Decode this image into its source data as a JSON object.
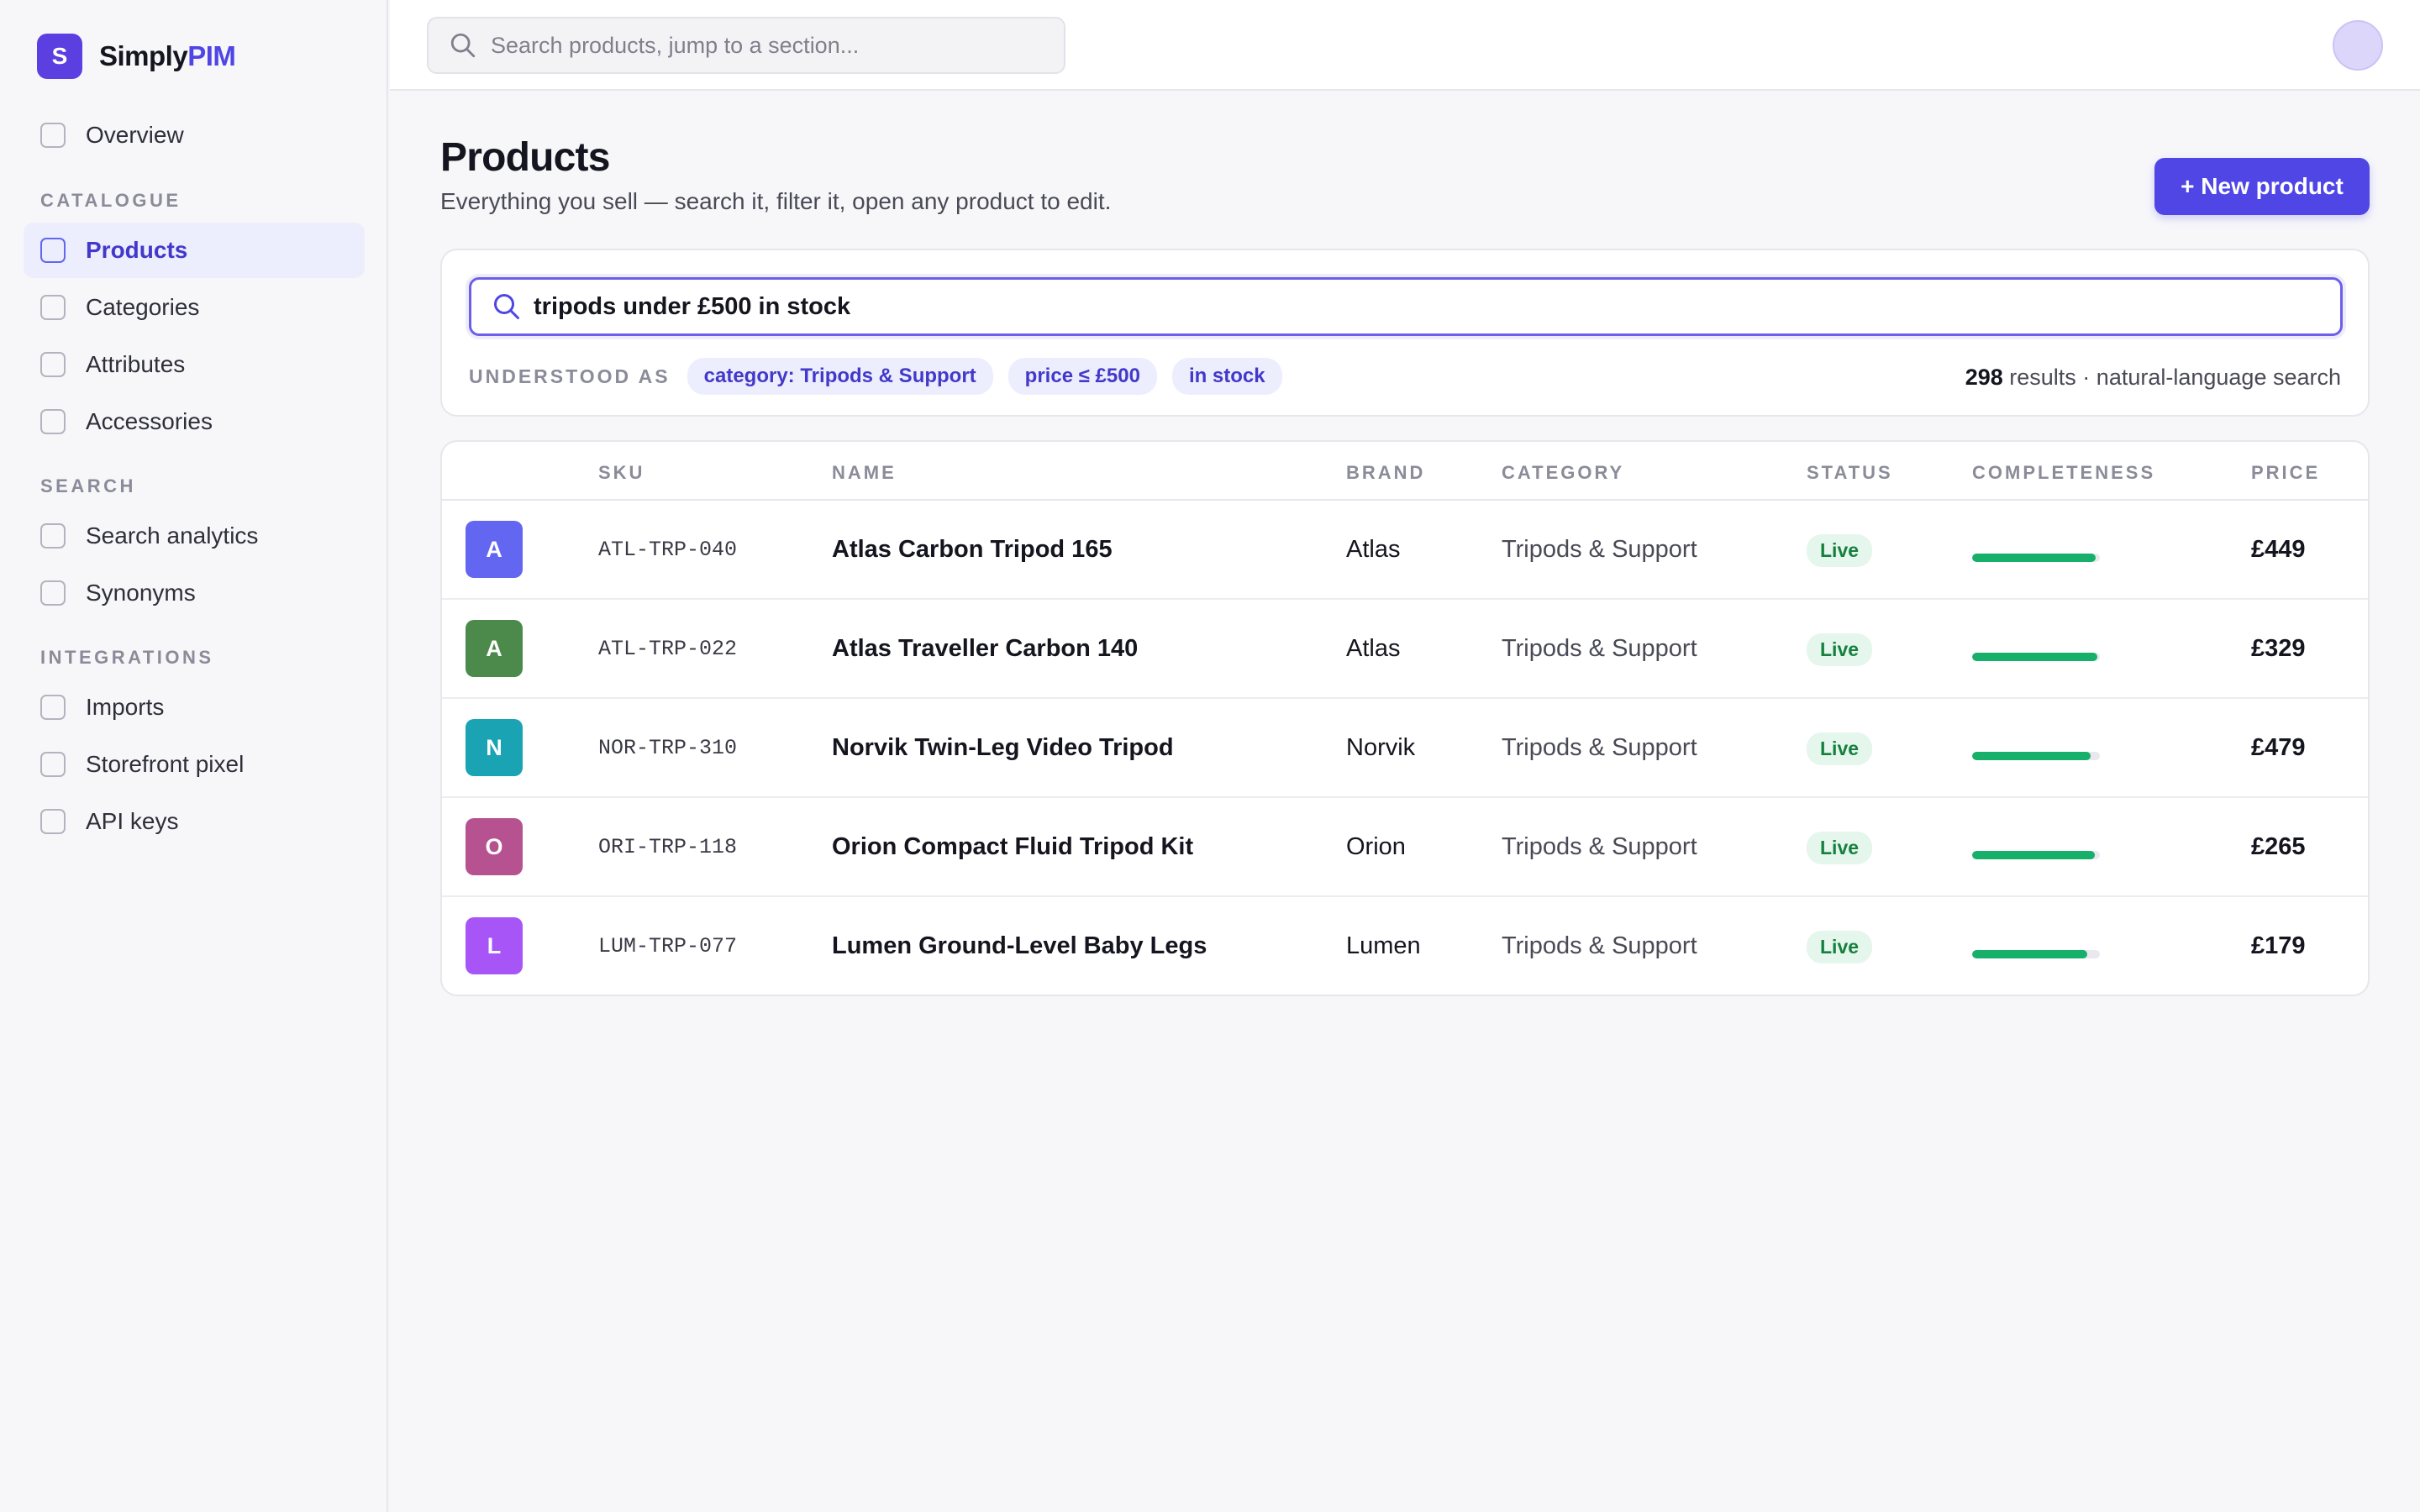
{
  "app": {
    "logo_letter": "S",
    "name_main": "Simply",
    "name_accent": "PIM",
    "accent_color": "#4f46e5"
  },
  "sidebar": {
    "overview": "Overview",
    "sections": {
      "catalogue": "CATALOGUE",
      "search": "SEARCH",
      "integrations": "INTEGRATIONS"
    },
    "items": [
      {
        "label": "Products",
        "active": true
      },
      {
        "label": "Categories"
      },
      {
        "label": "Attributes"
      },
      {
        "label": "Accessories"
      },
      {
        "label": "Search analytics"
      },
      {
        "label": "Synonyms"
      },
      {
        "label": "Imports"
      },
      {
        "label": "Storefront pixel"
      },
      {
        "label": "API keys"
      }
    ]
  },
  "topbar": {
    "search_placeholder": "Search products, jump to a section..."
  },
  "page": {
    "title": "Products",
    "subtitle": "Everything you sell — search it, filter it, open any product to edit.",
    "new_button": "+ New product"
  },
  "nl_search": {
    "query": "tripods under £500 in stock",
    "understood_label": "UNDERSTOOD AS",
    "chips": [
      "category: Tripods & Support",
      "price ≤ £500",
      "in stock"
    ],
    "result_count": "298",
    "result_suffix": " results · natural-language search"
  },
  "table": {
    "headers": {
      "sku": "SKU",
      "name": "NAME",
      "brand": "BRAND",
      "category": "CATEGORY",
      "status": "STATUS",
      "completeness": "COMPLETENESS",
      "price": "PRICE"
    },
    "rows": [
      {
        "initial": "A",
        "thumb_color": "#6366f1",
        "sku": "ATL-TRP-040",
        "name": "Atlas Carbon Tripod 165",
        "brand": "Atlas",
        "category": "Tripods & Support",
        "status": "Live",
        "completeness": 0.97,
        "price": "£449"
      },
      {
        "initial": "A",
        "thumb_color": "#4b8a4b",
        "sku": "ATL-TRP-022",
        "name": "Atlas Traveller Carbon 140",
        "brand": "Atlas",
        "category": "Tripods & Support",
        "status": "Live",
        "completeness": 0.98,
        "price": "£329"
      },
      {
        "initial": "N",
        "thumb_color": "#1aa3b3",
        "sku": "NOR-TRP-310",
        "name": "Norvik Twin-Leg Video Tripod",
        "brand": "Norvik",
        "category": "Tripods & Support",
        "status": "Live",
        "completeness": 0.93,
        "price": "£479"
      },
      {
        "initial": "O",
        "thumb_color": "#b5528f",
        "sku": "ORI-TRP-118",
        "name": "Orion Compact Fluid Tripod Kit",
        "brand": "Orion",
        "category": "Tripods & Support",
        "status": "Live",
        "completeness": 0.96,
        "price": "£265"
      },
      {
        "initial": "L",
        "thumb_color": "#a855f7",
        "sku": "LUM-TRP-077",
        "name": "Lumen Ground-Level Baby Legs",
        "brand": "Lumen",
        "category": "Tripods & Support",
        "status": "Live",
        "completeness": 0.9,
        "price": "£179"
      }
    ]
  }
}
